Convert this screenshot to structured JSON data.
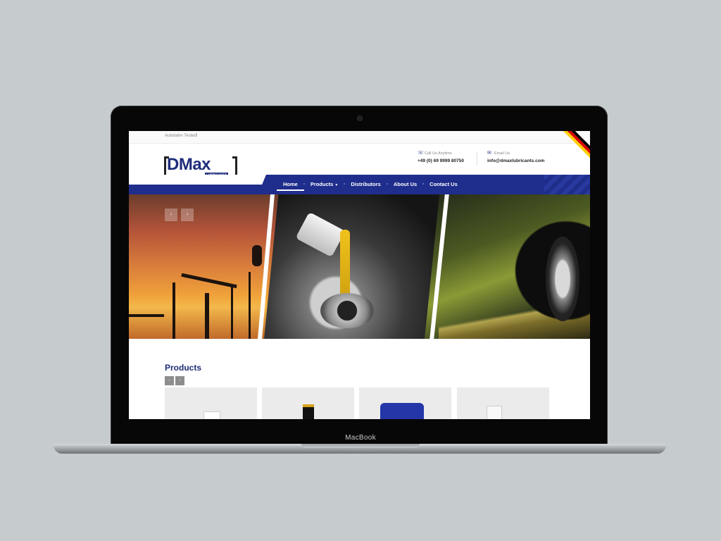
{
  "device": {
    "label": "MacBook"
  },
  "site": {
    "tagline": "Autobahn Tested!",
    "logo": {
      "main": "DMax",
      "sub": "LUBRICANTS"
    },
    "contact": {
      "call_label": "Call Us Anytime",
      "phone": "+49 (0) 69 9999 80750",
      "email_label": "Email Us",
      "email": "info@dmaxlubricants.com"
    },
    "nav": [
      {
        "label": "Home",
        "active": true
      },
      {
        "label": "Products",
        "has_dropdown": true
      },
      {
        "label": "Distributors"
      },
      {
        "label": "About Us"
      },
      {
        "label": "Contact Us"
      }
    ],
    "slider": {
      "prev_icon": "‹",
      "next_icon": "›"
    },
    "products": {
      "title": "Products",
      "prev_icon": "‹",
      "next_icon": "›"
    }
  },
  "colors": {
    "brand": "#1f2d8c",
    "accent": "#f0c21c",
    "flag": [
      "#000000",
      "#dd0000",
      "#ffce00"
    ]
  }
}
